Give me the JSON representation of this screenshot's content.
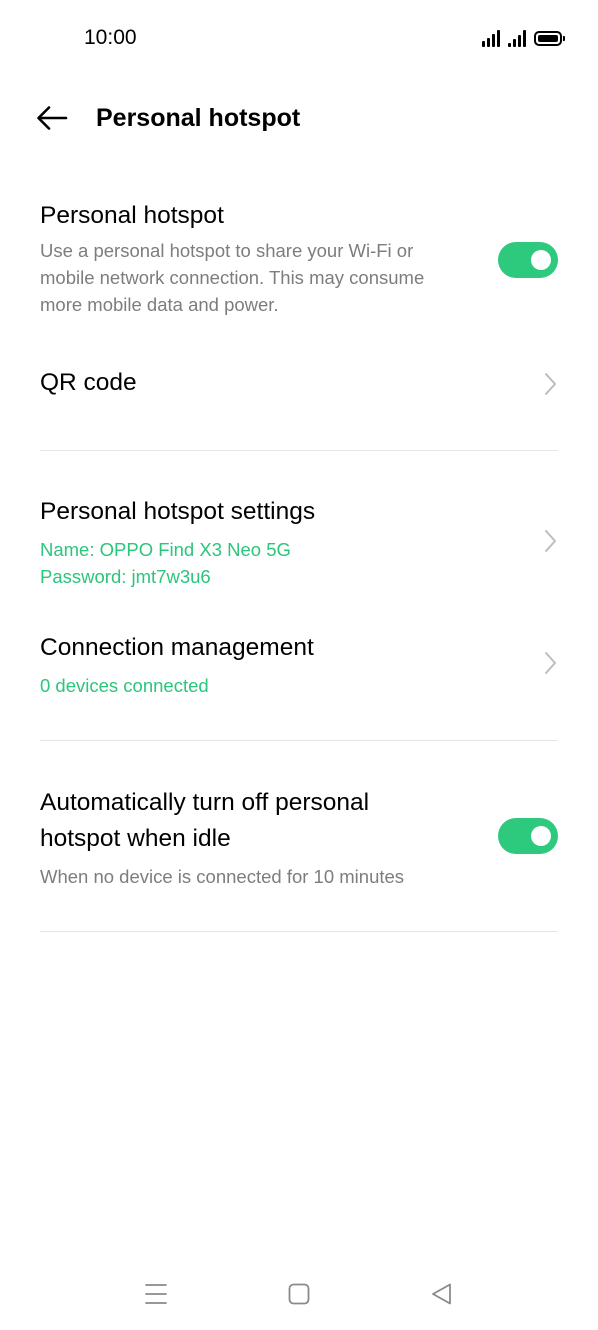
{
  "status_bar": {
    "time": "10:00",
    "icons": [
      "signal-icon",
      "signal-icon",
      "battery-icon"
    ]
  },
  "header": {
    "back_icon": "arrow-left-icon",
    "title": "Personal hotspot"
  },
  "hotspot_toggle_row": {
    "title": "Personal hotspot",
    "description_line1": "Use a personal hotspot to share your Wi-Fi or",
    "description_line2": "mobile network connection. This may consume",
    "description_line3": "more mobile data and power.",
    "toggle_state": "on"
  },
  "qr_code_row": {
    "title": "QR code",
    "icon": "chevron-right-icon"
  },
  "hotspot_settings_row": {
    "title": "Personal hotspot settings",
    "name_line": "Name: OPPO Find X3 Neo 5G",
    "password_line": "Password: jmt7w3u6",
    "icon": "chevron-right-icon"
  },
  "connection_row": {
    "title": "Connection management",
    "subtitle": "0 devices connected",
    "icon": "chevron-right-icon"
  },
  "auto_off_row": {
    "title_line1": "Automatically turn off personal",
    "title_line2": "hotspot when idle",
    "subtitle": "When no device is connected for 10 minutes",
    "toggle_state": "on"
  },
  "nav_bar": {
    "icons": [
      "menu-icon",
      "home-icon",
      "back-triangle-icon"
    ]
  },
  "colors": {
    "accent_green": "#2dca7e",
    "secondary_text": "#7d7d7d",
    "divider": "#e6e6e6"
  }
}
